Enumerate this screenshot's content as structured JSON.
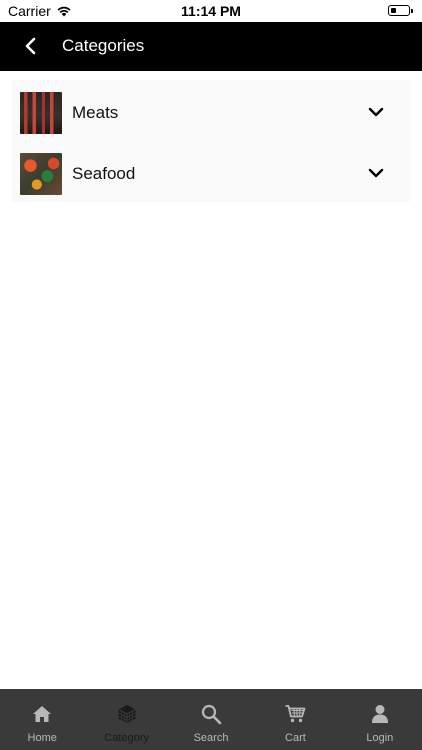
{
  "status_bar": {
    "carrier": "Carrier",
    "time": "11:14 PM",
    "battery_level": 0.3
  },
  "header": {
    "title": "Categories"
  },
  "categories": [
    {
      "label": "Meats"
    },
    {
      "label": "Seafood"
    }
  ],
  "tabs": [
    {
      "label": "Home",
      "icon": "home-icon"
    },
    {
      "label": "Category",
      "icon": "category-cube-icon",
      "active": true
    },
    {
      "label": "Search",
      "icon": "search-icon"
    },
    {
      "label": "Cart",
      "icon": "cart-icon"
    },
    {
      "label": "Login",
      "icon": "user-icon"
    }
  ],
  "colors": {
    "nav_background": "#000000",
    "tab_bar_background": "#3a3a3a",
    "tab_label": "#b8b8b8",
    "tab_label_active": "#1a1a1a"
  }
}
